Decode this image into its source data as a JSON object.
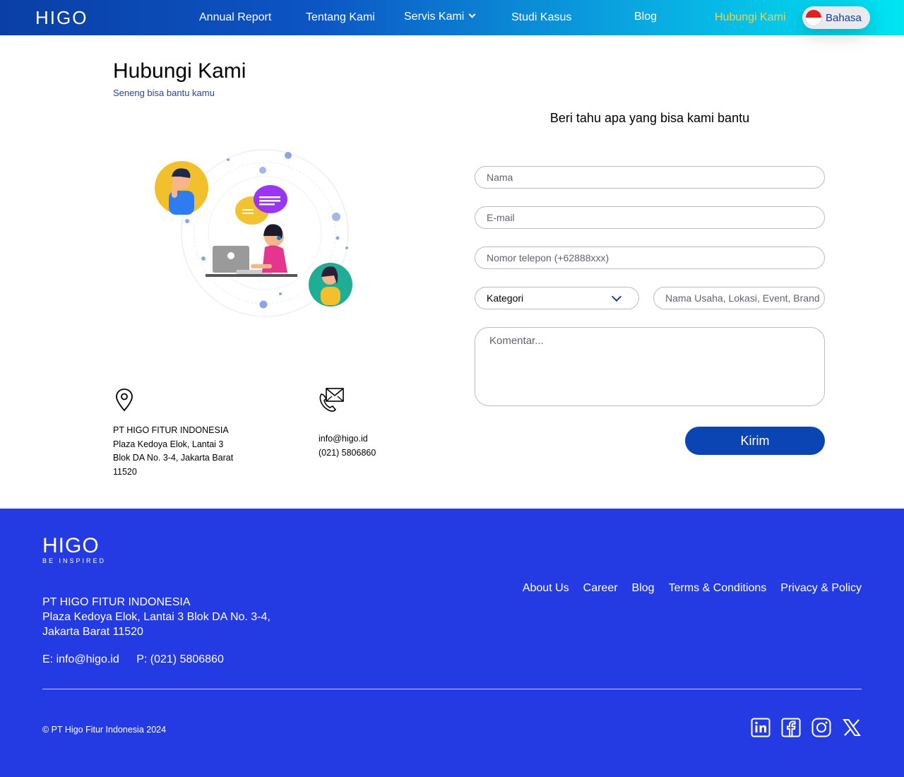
{
  "brand": {
    "logo": "HIGO"
  },
  "nav": {
    "items": [
      {
        "label": "Annual Report"
      },
      {
        "label": "Tentang Kami"
      },
      {
        "label": "Servis Kami"
      },
      {
        "label": "Studi Kasus"
      },
      {
        "label": "Blog"
      },
      {
        "label": "Hubungi Kami"
      }
    ],
    "active": "Hubungi Kami",
    "active_color": "#f7d046",
    "language_label": "Bahasa"
  },
  "page": {
    "title": "Hubungi Kami",
    "subtitle": "Seneng bisa bantu kamu"
  },
  "address": {
    "company": "PT HIGO FITUR INDONESIA",
    "line1": "Plaza Kedoya Elok, Lantai 3",
    "line2": "Blok DA No. 3-4, Jakarta Barat",
    "line3": "11520"
  },
  "contact": {
    "email": "info@higo.id",
    "phone": "(021) 5806860"
  },
  "form": {
    "heading": "Beri tahu apa yang bisa kami bantu",
    "name_placeholder": "Nama",
    "email_placeholder": "E-mail",
    "phone_placeholder": "Nomor telepon (+62888xxx)",
    "category_value": "Kategori",
    "business_placeholder": "Nama Usaha, Lokasi, Event, Brand",
    "comment_placeholder": "Komentar...",
    "submit_label": "Kirim"
  },
  "footer": {
    "logo": "HIGO",
    "tagline": "BE INSPIRED",
    "company": "PT HIGO FITUR INDONESIA",
    "address_line1": "Plaza Kedoya Elok, Lantai 3 Blok DA No. 3-4,",
    "address_line2": "Jakarta Barat 11520",
    "email": "E: info@higo.id",
    "phone": "P: (021) 5806860",
    "links": [
      "About Us",
      "Career",
      "Blog",
      "Terms & Conditions",
      "Privacy & Policy"
    ],
    "copyright": "© PT Higo Fitur Indonesia 2024",
    "social": [
      "linkedin-icon",
      "facebook-icon",
      "instagram-icon",
      "x-icon"
    ],
    "background": "#243ae3"
  }
}
